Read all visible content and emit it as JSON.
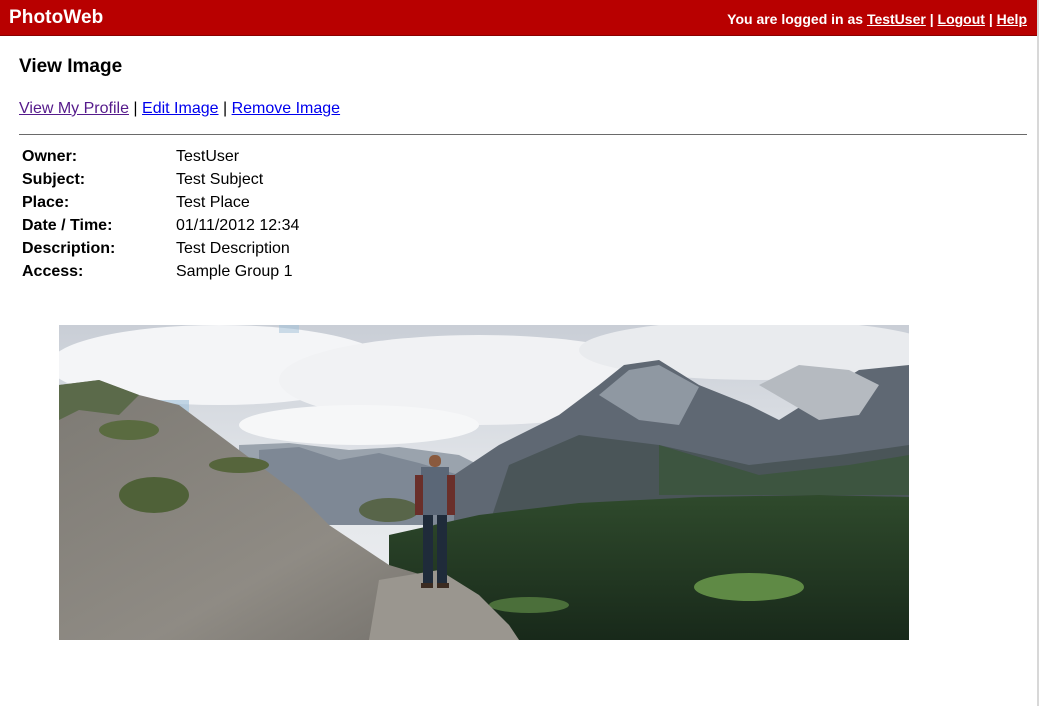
{
  "app": {
    "name": "PhotoWeb"
  },
  "userbar": {
    "prefix": "You are logged in as",
    "username": "TestUser",
    "logout_label": "Logout",
    "help_label": "Help",
    "separator": "|"
  },
  "page": {
    "title": "View Image"
  },
  "actions": {
    "view_profile_label": "View My Profile",
    "edit_image_label": "Edit Image",
    "remove_image_label": "Remove Image",
    "separator": "|"
  },
  "details": {
    "owner_label": "Owner:",
    "owner_value": "TestUser",
    "subject_label": "Subject:",
    "subject_value": "Test Subject",
    "place_label": "Place:",
    "place_value": "Test Place",
    "datetime_label": "Date / Time:",
    "datetime_value": "01/11/2012 12:34",
    "description_label": "Description:",
    "description_value": "Test Description",
    "access_label": "Access:",
    "access_value": "Sample Group 1"
  },
  "colors": {
    "header_bg": "#b80000",
    "link": "#0000ee",
    "visited_link": "#551a8b"
  }
}
